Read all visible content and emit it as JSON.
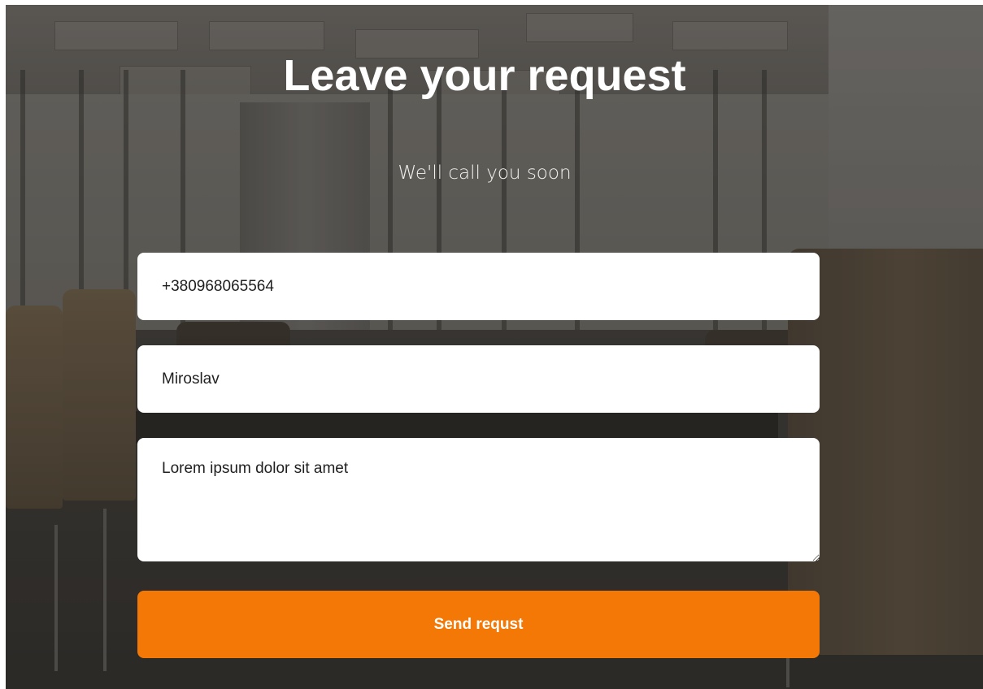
{
  "form": {
    "title": "Leave your request",
    "subtitle": "We'll call you soon",
    "phone_value": "+380968065564",
    "name_value": "Miroslav",
    "message_value": "Lorem ipsum dolor sit amet",
    "submit_label": "Send requst"
  },
  "colors": {
    "accent": "#f47805",
    "field_background": "#ffffff",
    "title_text": "#ffffff"
  }
}
